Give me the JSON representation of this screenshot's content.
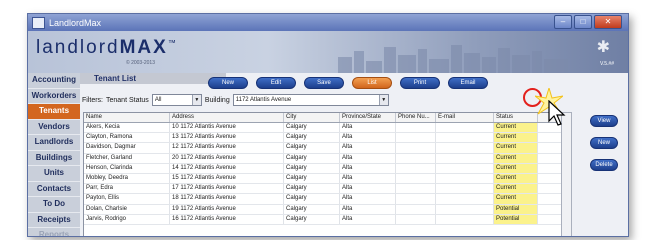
{
  "window": {
    "title": "LandlordMax"
  },
  "banner": {
    "logo_light": "landlord",
    "logo_bold": "MAX",
    "tm": "™",
    "copyright": "© 2003-2013",
    "version": "V.5.##"
  },
  "sidebar": {
    "items": [
      {
        "label": "Accounting",
        "active": false
      },
      {
        "label": "Workorders",
        "active": false
      },
      {
        "label": "Tenants",
        "active": true
      },
      {
        "label": "Vendors",
        "active": false
      },
      {
        "label": "Landlords",
        "active": false
      },
      {
        "label": "Buildings",
        "active": false
      },
      {
        "label": "Units",
        "active": false
      },
      {
        "label": "Contacts",
        "active": false
      },
      {
        "label": "To Do",
        "active": false
      },
      {
        "label": "Receipts",
        "active": false
      },
      {
        "label": "Reports",
        "active": false
      }
    ]
  },
  "main": {
    "tab_title": "Tenant List",
    "toolbar": [
      "New",
      "Edit",
      "Save",
      "List",
      "Print",
      "Email"
    ],
    "active_toolbar": "List",
    "filters": {
      "label": "Filters:",
      "status_label": "Tenant Status",
      "status_value": "All",
      "building_label": "Building",
      "building_value": "1172 Atlantis Avenue"
    },
    "table": {
      "columns": [
        "Name",
        "Address",
        "City",
        "Province/State",
        "Phone Nu...",
        "E-mail",
        "Status",
        ""
      ],
      "rows": [
        [
          "Akers, Kecia",
          "10 1172 Atlantis Avenue",
          "Calgary",
          "Alta",
          "",
          "",
          "Current"
        ],
        [
          "Clayton, Ramona",
          "13 1172 Atlantis Avenue",
          "Calgary",
          "Alta",
          "",
          "",
          "Current"
        ],
        [
          "Davidson, Dagmar",
          "12 1172 Atlantis Avenue",
          "Calgary",
          "Alta",
          "",
          "",
          "Current"
        ],
        [
          "Fletcher, Garland",
          "20 1172 Atlantis Avenue",
          "Calgary",
          "Alta",
          "",
          "",
          "Current"
        ],
        [
          "Henson, Clarinda",
          "14 1172 Atlantis Avenue",
          "Calgary",
          "Alta",
          "",
          "",
          "Current"
        ],
        [
          "Mobley, Deedra",
          "15 1172 Atlantis Avenue",
          "Calgary",
          "Alta",
          "",
          "",
          "Current"
        ],
        [
          "Parr, Edra",
          "17 1172 Atlantis Avenue",
          "Calgary",
          "Alta",
          "",
          "",
          "Current"
        ],
        [
          "Payton, Ellis",
          "18 1172 Atlantis Avenue",
          "Calgary",
          "Alta",
          "",
          "",
          "Current"
        ],
        [
          "Dolan, Charlsie",
          "19 1172 Atlantis Avenue",
          "Calgary",
          "Alta",
          "",
          "",
          "Potential"
        ],
        [
          "Jarvis, Rodrigo",
          "16 1172 Atlantis Avenue",
          "Calgary",
          "Alta",
          "",
          "",
          "Potential"
        ]
      ]
    },
    "side_buttons": [
      "View",
      "New",
      "Delete"
    ]
  },
  "colors": {
    "accent": "#d3661f",
    "button_blue": "#2a55ac",
    "status_highlight": "#fbf28c",
    "callout_circle": "#e3211d"
  }
}
